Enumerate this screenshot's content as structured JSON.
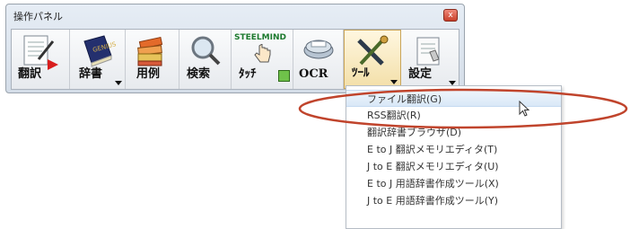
{
  "window": {
    "title": "操作パネル",
    "close_glyph": "x"
  },
  "toolbar": {
    "tools": [
      {
        "id": "honyaku",
        "label": "翻訳",
        "has_dropdown": false,
        "icon": "translate-document-icon"
      },
      {
        "id": "jisho",
        "label": "辞書",
        "has_dropdown": true,
        "icon": "dictionary-book-icon"
      },
      {
        "id": "yourei",
        "label": "用例",
        "has_dropdown": false,
        "icon": "example-books-icon"
      },
      {
        "id": "kensaku",
        "label": "検索",
        "has_dropdown": false,
        "icon": "magnifier-icon"
      },
      {
        "id": "touch",
        "label": "ﾀｯﾁ",
        "has_dropdown": false,
        "icon": "steel-mind-hand-icon",
        "logo_text": "STEELMIND"
      },
      {
        "id": "ocr",
        "label": "OCR",
        "has_dropdown": false,
        "icon": "scanner-icon"
      },
      {
        "id": "tool",
        "label": "ﾂｰﾙ",
        "has_dropdown": true,
        "icon": "tools-icon",
        "active": true
      },
      {
        "id": "settei",
        "label": "設定",
        "has_dropdown": true,
        "icon": "settings-document-icon"
      }
    ]
  },
  "menu": {
    "items": [
      "ファイル翻訳(G)",
      "RSS翻訳(R)",
      "翻訳辞書ブラウザ(D)",
      "E to J 翻訳メモリエディタ(T)",
      "J to E 翻訳メモリエディタ(U)",
      "E to J 用語辞書作成ツール(X)",
      "J to E 用語辞書作成ツール(Y)"
    ],
    "highlighted_index": 0
  },
  "annotation": {
    "ellipse_color": "#c0442c"
  }
}
